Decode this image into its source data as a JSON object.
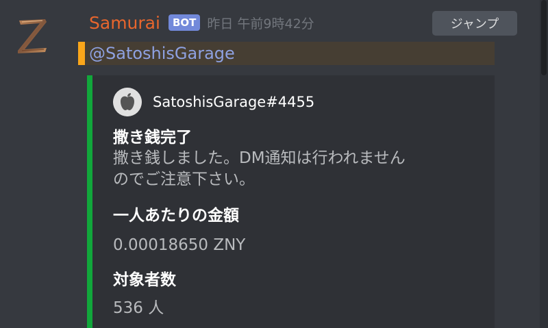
{
  "message": {
    "author": {
      "name": "Samurai",
      "bot_tag": "BOT",
      "avatar": "z-logo",
      "name_color": "#e8662d"
    },
    "timestamp": "昨日 午前9時42分",
    "jump_label": "ジャンプ",
    "mention": "@SatoshisGarage"
  },
  "embed": {
    "accent_color": "#11a73b",
    "author": {
      "name": "SatoshisGarage#4455",
      "avatar": "apple-logo-avatar"
    },
    "title": "撒き銭完了",
    "description_line1": "撒き銭しました。DM通知は行われません",
    "description_line2": "のでご注意下さい。",
    "fields": [
      {
        "name": "一人あたりの金額",
        "value": "0.00018650 ZNY"
      },
      {
        "name": "対象者数",
        "value": "536 人"
      }
    ]
  }
}
